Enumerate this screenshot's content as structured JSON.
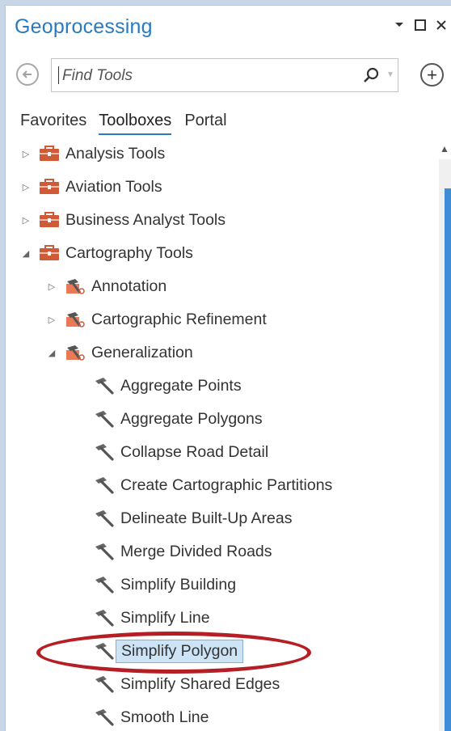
{
  "pane": {
    "title": "Geoprocessing",
    "search": {
      "placeholder": "Find Tools"
    },
    "tabs": [
      "Favorites",
      "Toolboxes",
      "Portal"
    ],
    "active_tab": "Toolboxes"
  },
  "tree": [
    {
      "label": "Analysis Tools",
      "type": "toolbox",
      "level": 0,
      "expanded": false
    },
    {
      "label": "Aviation Tools",
      "type": "toolbox",
      "level": 0,
      "expanded": false
    },
    {
      "label": "Business Analyst Tools",
      "type": "toolbox",
      "level": 0,
      "expanded": false
    },
    {
      "label": "Cartography Tools",
      "type": "toolbox",
      "level": 0,
      "expanded": true
    },
    {
      "label": "Annotation",
      "type": "toolset",
      "level": 1,
      "expanded": false
    },
    {
      "label": "Cartographic Refinement",
      "type": "toolset",
      "level": 1,
      "expanded": false
    },
    {
      "label": "Generalization",
      "type": "toolset",
      "level": 1,
      "expanded": true
    },
    {
      "label": "Aggregate Points",
      "type": "tool",
      "level": 2
    },
    {
      "label": "Aggregate Polygons",
      "type": "tool",
      "level": 2
    },
    {
      "label": "Collapse Road Detail",
      "type": "tool",
      "level": 2
    },
    {
      "label": "Create Cartographic Partitions",
      "type": "tool",
      "level": 2
    },
    {
      "label": "Delineate Built-Up Areas",
      "type": "tool",
      "level": 2
    },
    {
      "label": "Merge Divided Roads",
      "type": "tool",
      "level": 2
    },
    {
      "label": "Simplify Building",
      "type": "tool",
      "level": 2
    },
    {
      "label": "Simplify Line",
      "type": "tool",
      "level": 2
    },
    {
      "label": "Simplify Polygon",
      "type": "tool",
      "level": 2,
      "selected": true
    },
    {
      "label": "Simplify Shared Edges",
      "type": "tool",
      "level": 2
    },
    {
      "label": "Smooth Line",
      "type": "tool",
      "level": 2
    }
  ],
  "colors": {
    "title": "#2a7ac0",
    "toolbox_icon": "#d05a35",
    "selection": "#cde3f6",
    "annotation_ellipse": "#b61e25"
  }
}
